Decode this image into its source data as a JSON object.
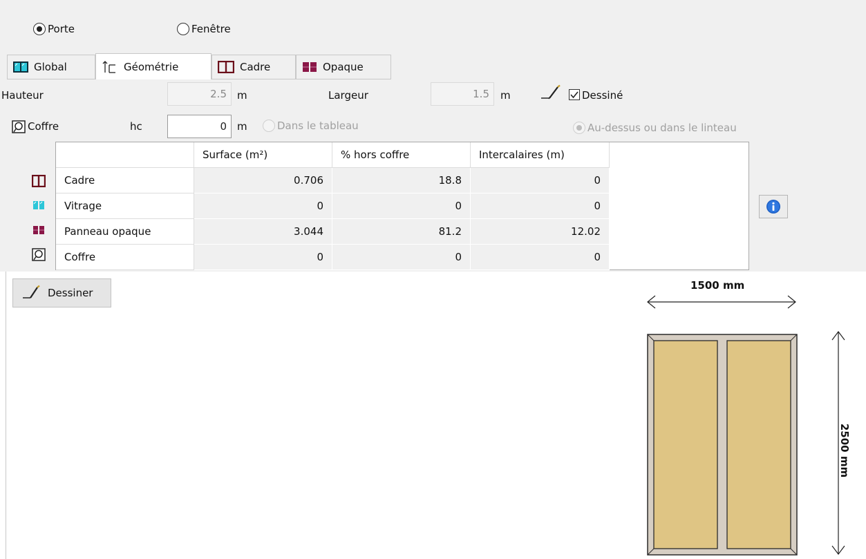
{
  "type_selector": {
    "porte_label": "Porte",
    "porte_selected": true,
    "fenetre_label": "Fenêtre",
    "fenetre_selected": false
  },
  "tabs": [
    {
      "label": "Global",
      "icon": "glazing-icon",
      "active": false
    },
    {
      "label": "Géométrie",
      "icon": "dimension-icon",
      "active": true
    },
    {
      "label": "Cadre",
      "icon": "frame-icon",
      "active": false
    },
    {
      "label": "Opaque",
      "icon": "opaque-panel-icon",
      "active": false
    }
  ],
  "geometry": {
    "hauteur_label": "Hauteur",
    "hauteur_value": "2.5",
    "hauteur_unit": "m",
    "largeur_label": "Largeur",
    "largeur_value": "1.5",
    "largeur_unit": "m",
    "dessine_label": "Dessiné",
    "dessine_checked": true
  },
  "coffre": {
    "label": "Coffre",
    "hc_label": "hc",
    "hc_value": "0",
    "hc_unit": "m",
    "dans_tableau_label": "Dans le tableau",
    "au_dessus_label": "Au-dessus ou dans le linteau",
    "au_dessus_selected": true
  },
  "table": {
    "headers": [
      "",
      "Surface (m²)",
      "% hors coffre",
      "Intercalaires (m)"
    ],
    "rows": [
      {
        "name": "Cadre",
        "icon": "frame-icon",
        "surface": "0.706",
        "hors_coffre": "18.8",
        "intercalaires": "0"
      },
      {
        "name": "Vitrage",
        "icon": "glazing-icon",
        "surface": "0",
        "hors_coffre": "0",
        "intercalaires": "0"
      },
      {
        "name": "Panneau opaque",
        "icon": "opaque-panel-icon",
        "surface": "3.044",
        "hors_coffre": "81.2",
        "intercalaires": "12.02"
      },
      {
        "name": "Coffre",
        "icon": "shutter-box-icon",
        "surface": "0",
        "hors_coffre": "0",
        "intercalaires": "0"
      }
    ]
  },
  "dessiner_button": "Dessiner",
  "drawing": {
    "width_label": "1500 mm",
    "height_label": "2500 mm",
    "panel_color": "#dfc584",
    "frame_color": "#d6cec3"
  },
  "colors": {
    "frame_icon": "#6b0f1a",
    "glazing_icon": "#2cc6d8",
    "opaque_icon": "#8a1747",
    "info_blue": "#1d5fc4"
  }
}
